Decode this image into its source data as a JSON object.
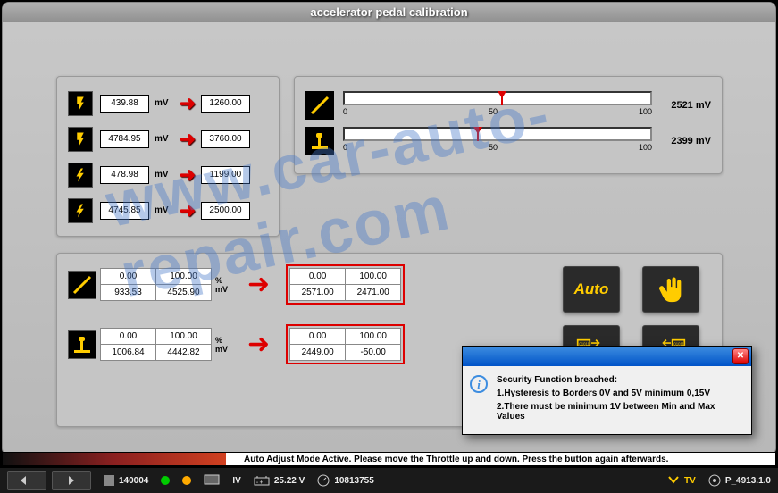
{
  "window": {
    "title": "accelerator pedal calibration"
  },
  "voltages": [
    {
      "value": "439.88",
      "unit": "mV",
      "target": "1260.00"
    },
    {
      "value": "4784.95",
      "unit": "mV",
      "target": "3760.00"
    },
    {
      "value": "478.98",
      "unit": "mV",
      "target": "1199.00"
    },
    {
      "value": "4745.85",
      "unit": "mV",
      "target": "2500.00"
    }
  ],
  "sliders": [
    {
      "value": "2521",
      "unit": "mV",
      "pos_pct": 50,
      "scale": [
        "0",
        "50",
        "100"
      ]
    },
    {
      "value": "2399",
      "unit": "mV",
      "pos_pct": 42,
      "scale": [
        "0",
        "50",
        "100"
      ]
    }
  ],
  "tables": [
    {
      "left": [
        [
          "0.00",
          "100.00"
        ],
        [
          "933.53",
          "4525.90"
        ]
      ],
      "units": [
        "%",
        "mV"
      ],
      "right": [
        [
          "0.00",
          "100.00"
        ],
        [
          "2571.00",
          "2471.00"
        ]
      ]
    },
    {
      "left": [
        [
          "0.00",
          "100.00"
        ],
        [
          "1006.84",
          "4442.82"
        ]
      ],
      "units": [
        "%",
        "mV"
      ],
      "right": [
        [
          "0.00",
          "100.00"
        ],
        [
          "2449.00",
          "-50.00"
        ]
      ]
    }
  ],
  "buttons": {
    "auto": "Auto"
  },
  "dialog": {
    "heading": "Security Function breached:",
    "line1": "1.Hysteresis to Borders 0V and 5V minimum 0,15V",
    "line2": "2.There must be minimum 1V between Min and Max Values"
  },
  "instruction": "Auto Adjust Mode Active. Please move the Throttle up and down. Press the button again afterwards.",
  "status": {
    "counter": "140004",
    "voltage": "25.22 V",
    "iv": "IV",
    "odo": "10813755",
    "tv_label": "TV",
    "pid": "P_4913.1.0"
  },
  "watermark": "www.car-auto-repair.com"
}
